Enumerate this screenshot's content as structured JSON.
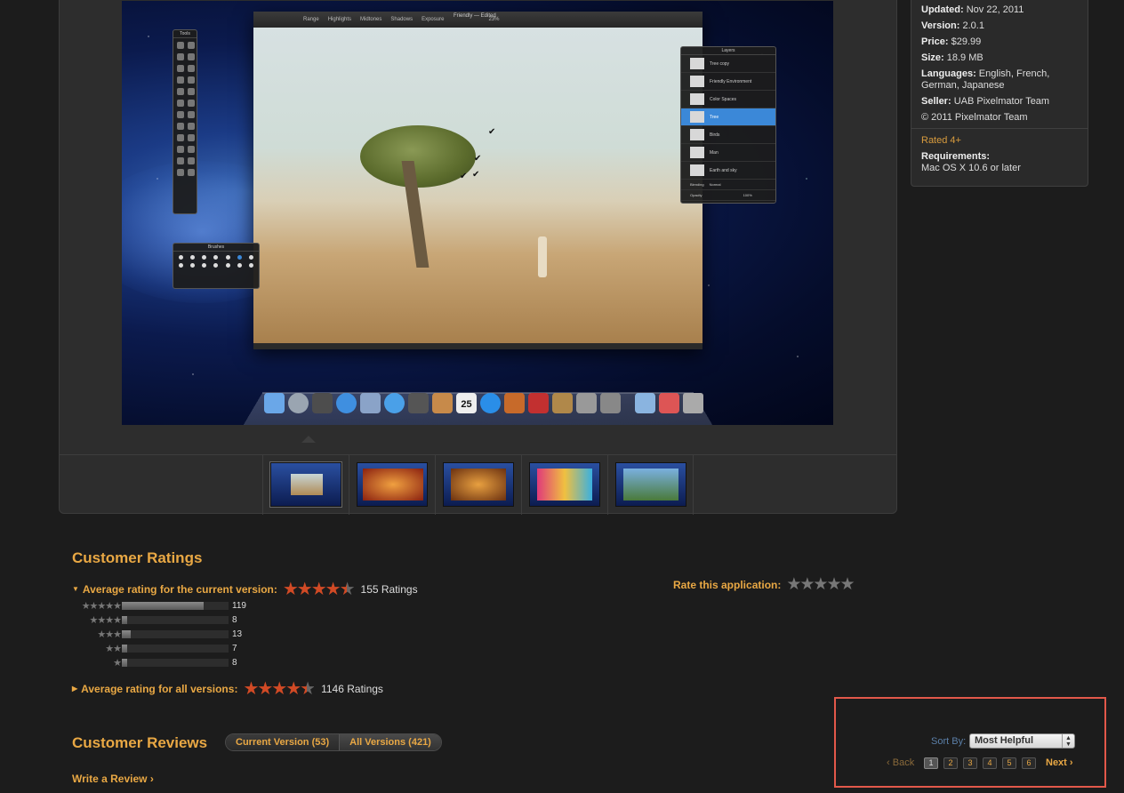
{
  "screenshot_app": {
    "title": "Friendly — Edited",
    "toolbar_items": [
      "Range",
      "Highlights",
      "Midtones",
      "Shadows",
      "Exposure",
      "23%"
    ],
    "tools_panel": "Tools",
    "brushes_panel": "Brushes",
    "layers_panel": {
      "title": "Layers",
      "rows": [
        "Tree copy",
        "Friendly Environment",
        "Color Spaces",
        "Tree",
        "Birds",
        "Man",
        "Earth and sky"
      ],
      "blending_label": "Blending",
      "blending_value": "Normal",
      "opacity_label": "Opacity",
      "opacity_value": "100%"
    },
    "dock_calendar_day": "25"
  },
  "thumbnails": [
    "screenshot-1",
    "screenshot-2",
    "screenshot-3",
    "screenshot-4",
    "screenshot-5"
  ],
  "info": {
    "updated_label": "Updated:",
    "updated": "Nov 22, 2011",
    "version_label": "Version:",
    "version": "2.0.1",
    "price_label": "Price:",
    "price": "$29.99",
    "size_label": "Size:",
    "size": "18.9 MB",
    "languages_label": "Languages:",
    "languages": "English, French, German, Japanese",
    "seller_label": "Seller:",
    "seller": "UAB Pixelmator Team",
    "copyright": "© 2011 Pixelmator Team",
    "rated": "Rated 4+",
    "requirements_label": "Requirements:",
    "requirements": "Mac OS X 10.6 or later"
  },
  "ratings": {
    "heading": "Customer Ratings",
    "current_label": "Average rating for the current version:",
    "current_count": "155 Ratings",
    "current_stars": 4.5,
    "breakdown": [
      {
        "stars": 5,
        "count": "119",
        "fraction": 0.77
      },
      {
        "stars": 4,
        "count": "8",
        "fraction": 0.05
      },
      {
        "stars": 3,
        "count": "13",
        "fraction": 0.08
      },
      {
        "stars": 2,
        "count": "7",
        "fraction": 0.05
      },
      {
        "stars": 1,
        "count": "8",
        "fraction": 0.05
      }
    ],
    "all_label": "Average rating for all versions:",
    "all_count": "1146 Ratings",
    "all_stars": 4.5,
    "rate_label": "Rate this application:"
  },
  "reviews": {
    "heading": "Customer Reviews",
    "tab_current": "Current Version (53)",
    "tab_all": "All Versions (421)",
    "write_review": "Write a Review",
    "sort_by_label": "Sort By:",
    "sort_value": "Most Helpful",
    "back": "Back",
    "next": "Next",
    "pages": [
      "1",
      "2",
      "3",
      "4",
      "5",
      "6"
    ],
    "current_page": "1"
  },
  "colors": {
    "accent": "#e9a844",
    "star": "#d14a25",
    "highlight_box": "#e2584a",
    "link_blue": "#5b7fa8"
  }
}
